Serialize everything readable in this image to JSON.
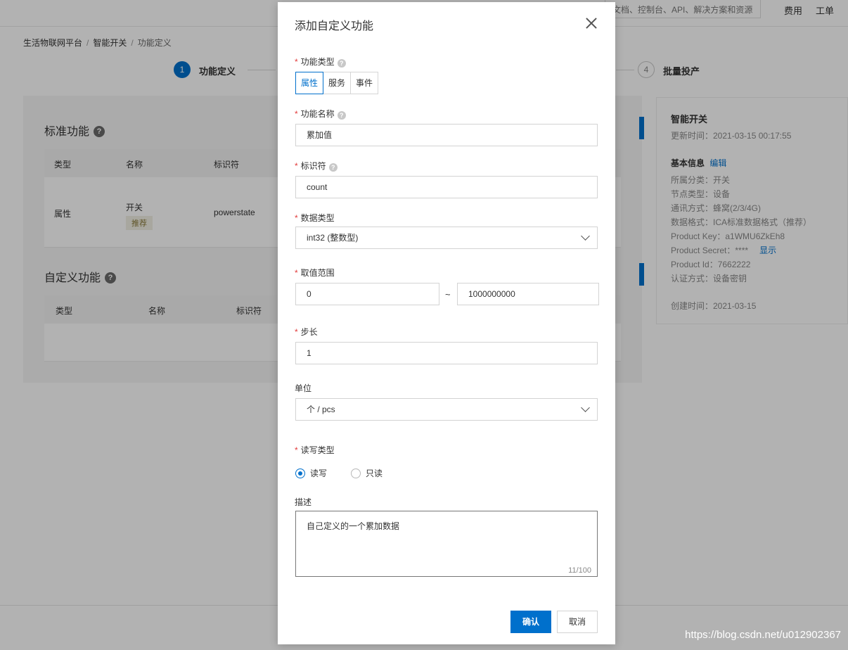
{
  "topbar": {
    "search_text": "文档、控制台、API、解决方案和资源",
    "links": [
      "费用",
      "工单"
    ]
  },
  "breadcrumb": [
    "生活物联网平台",
    "智能开关",
    "功能定义"
  ],
  "steps": [
    {
      "number": "1",
      "label": "功能定义",
      "active": true
    },
    {
      "number": "4",
      "label": "批量投产",
      "active": false
    }
  ],
  "standard": {
    "title": "标准功能",
    "columns": [
      "类型",
      "名称",
      "标识符"
    ],
    "rows": [
      {
        "type": "属性",
        "name": "开关",
        "tag": "推荐",
        "identifier": "powerstate"
      }
    ]
  },
  "custom": {
    "title": "自定义功能",
    "columns": [
      "类型",
      "名称",
      "标识符"
    ]
  },
  "product": {
    "name": "智能开关",
    "updated": "更新时间：2021-03-15 00:17:55",
    "basic_info_label": "基本信息",
    "edit_label": "编辑",
    "category": "所属分类：开关",
    "node_type": "节点类型：设备",
    "network": "通讯方式：蜂窝(2/3/4G)",
    "data_format": "数据格式：ICA标准数据格式（推荐）",
    "product_key": "Product Key：a1WMU6ZkEh8",
    "product_secret": "Product Secret：****",
    "show_label": "显示",
    "product_id": "Product Id：7662222",
    "auth": "认证方式：设备密钥",
    "created": "创建时间：2021-03-15"
  },
  "watermark": "https://blog.csdn.net/u012902367",
  "modal": {
    "title": "添加自定义功能",
    "feature_type": {
      "label": "功能类型",
      "options": [
        "属性",
        "服务",
        "事件"
      ],
      "selected": "属性"
    },
    "name": {
      "label": "功能名称",
      "value": "累加值"
    },
    "identifier": {
      "label": "标识符",
      "value": "count"
    },
    "data_type": {
      "label": "数据类型",
      "value": "int32 (整数型)"
    },
    "range": {
      "label": "取值范围",
      "min": "0",
      "separator": "~",
      "max": "1000000000"
    },
    "step": {
      "label": "步长",
      "value": "1"
    },
    "unit": {
      "label": "单位",
      "value": "个 / pcs"
    },
    "rw": {
      "label": "读写类型",
      "options": [
        "读写",
        "只读"
      ],
      "selected": "读写"
    },
    "description": {
      "label": "描述",
      "value": "自己定义的一个累加数据",
      "counter": "11/100"
    },
    "confirm_label": "确认",
    "cancel_label": "取消"
  },
  "colors": {
    "primary": "#0070cc",
    "required": "#e23c3c"
  }
}
